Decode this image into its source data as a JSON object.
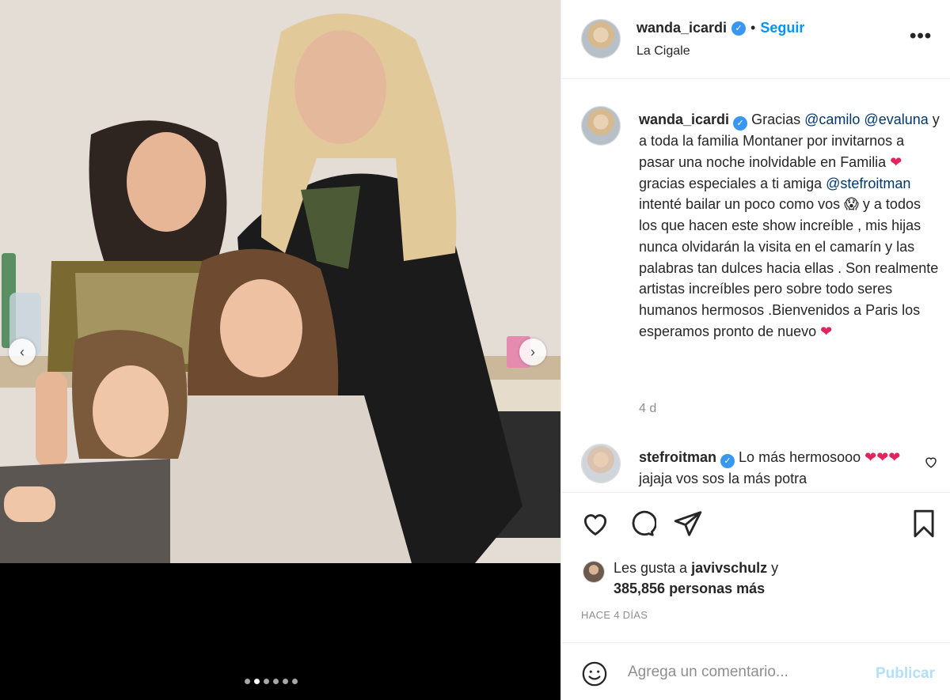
{
  "post": {
    "dots_count": 6,
    "active_dot": 1
  },
  "header": {
    "username": "wanda_icardi",
    "separator": "•",
    "follow_label": "Seguir",
    "location": "La Cigale",
    "more_label": "•••"
  },
  "caption": {
    "username": "wanda_icardi",
    "parts": {
      "p1": "Gracias ",
      "m1": "@camilo",
      "p2": " ",
      "m2": "@evaluna",
      "p3": " y a toda la familia Montaner por invitarnos a pasar una noche inolvidable en Familia ",
      "e1": "❤",
      "p4": " gracias especiales a ti amiga ",
      "m3": "@stefroitman",
      "p5": " intenté bailar un poco como vos ",
      "e2": "😱",
      "p6": " y a todos los que hacen este show increíble , mis hijas nunca olvidarán la visita en el camarín y las palabras tan dulces hacia ellas . Son realmente artistas increíbles pero sobre todo seres humanos hermosos .Bienvenidos a Paris los esperamos pronto de nuevo ",
      "e3": "❤"
    },
    "time": "4 d"
  },
  "comment": {
    "username": "stefroitman",
    "text1": " Lo más hermosooo ",
    "hearts": "❤❤❤",
    "text2": " jajaja vos sos la más potra"
  },
  "likes": {
    "prefix": "Les gusta a ",
    "liker": "javivschulz",
    "suffix": " y",
    "count_line": "385,856 personas más"
  },
  "ago": "HACE 4 DÍAS",
  "add_comment": {
    "placeholder": "Agrega un comentario...",
    "publish_label": "Publicar"
  },
  "colors": {
    "accent": "#0095f6",
    "mention": "#00376b",
    "verified": "#3897f0",
    "heart": "#e0245e"
  },
  "icons": [
    "verified-badge-icon",
    "more-options-icon",
    "heart-icon",
    "comment-icon",
    "share-icon",
    "bookmark-icon",
    "emoji-icon",
    "chevron-left-icon",
    "chevron-right-icon"
  ]
}
